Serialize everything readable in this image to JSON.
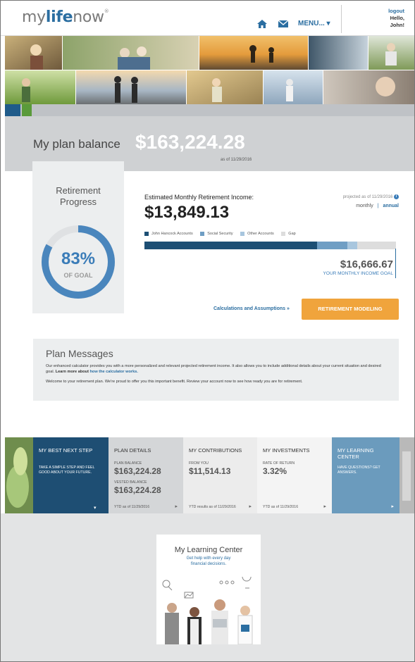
{
  "header": {
    "logo_pre": "my",
    "logo_bold": "life",
    "logo_post": "now",
    "logo_mark": "®",
    "menu_label": "MENU... ▾",
    "logout_label": "logout",
    "greeting": "Hello,",
    "user_name": "John!"
  },
  "icons": {
    "home": "home-icon",
    "mail": "mail-icon",
    "info": "info-icon"
  },
  "balance": {
    "label": "My plan balance",
    "value": "$163,224.28",
    "as_of": "as of 11/29/2016"
  },
  "progress": {
    "title_line1": "Retirement",
    "title_line2": "Progress",
    "percent_label": "83%",
    "percent_value": 0.83,
    "sub_label": "OF GOAL"
  },
  "estimate": {
    "label": "Estimated Monthly Retirement Income:",
    "value": "$13,849.13",
    "projected": "projected as of 11/29/2016",
    "info_glyph": "i",
    "period_monthly": "monthly",
    "period_sep": "|",
    "period_annual": "annual",
    "legend": [
      {
        "label": "John Hancock Accounts",
        "color": "#1d4f74"
      },
      {
        "label": "Social Security",
        "color": "#6f9ec4"
      },
      {
        "label": "Other Accounts",
        "color": "#a8c6de"
      },
      {
        "label": "Gap",
        "color": "#dddddd"
      }
    ],
    "bar_fractions": {
      "john_hancock": 0.685,
      "social_security": 0.12,
      "other": 0.04
    },
    "goal_value": "$16,666.67",
    "goal_label": "YOUR MONTHLY INCOME GOAL"
  },
  "actions": {
    "calc_link": "Calculations and Assumptions »",
    "modeling_button": "RETIREMENT MODELING"
  },
  "messages": {
    "title": "Plan Messages",
    "p1_a": "Our enhanced calculator provides you with a more personalized and relevant projected retirement income. It also allows you to include additional details about your current situation and desired goal. ",
    "p1_b": "Learn more about ",
    "p1_link": "how the calculator works.",
    "p2": "Welcome to your retirement plan. We're proud to offer you this important benefit. Review your account now to see how ready you are for retirement."
  },
  "tiles": {
    "best_next": {
      "title": "MY BEST NEXT STEP",
      "body": "TAKE A SIMPLE STEP AND FEEL GOOD ABOUT YOUR FUTURE."
    },
    "plan_details": {
      "title": "PLAN DETAILS",
      "bal_label": "PLAN BALANCE",
      "bal_value": "$163,224.28",
      "vested_label": "VESTED BALANCE",
      "vested_value": "$163,224.28",
      "ytd": "YTD as of 11/29/2016"
    },
    "contributions": {
      "title": "MY CONTRIBUTIONS",
      "from_label": "FROM YOU",
      "from_value": "$11,514.13",
      "ytd": "YTD results as of 11/29/2016"
    },
    "investments": {
      "title": "MY INVESTMENTS",
      "rate_label": "RATE OF RETURN",
      "rate_value": "3.32%",
      "ytd": "YTD as of 11/29/2016"
    },
    "learning": {
      "title": "MY LEARNING CENTER",
      "body": "HAVE QUESTIONS? GET ANSWERS."
    }
  },
  "learning_card": {
    "title": "My Learning Center",
    "sub_line1": "Get help with every day",
    "sub_line2": "financial decisions."
  }
}
